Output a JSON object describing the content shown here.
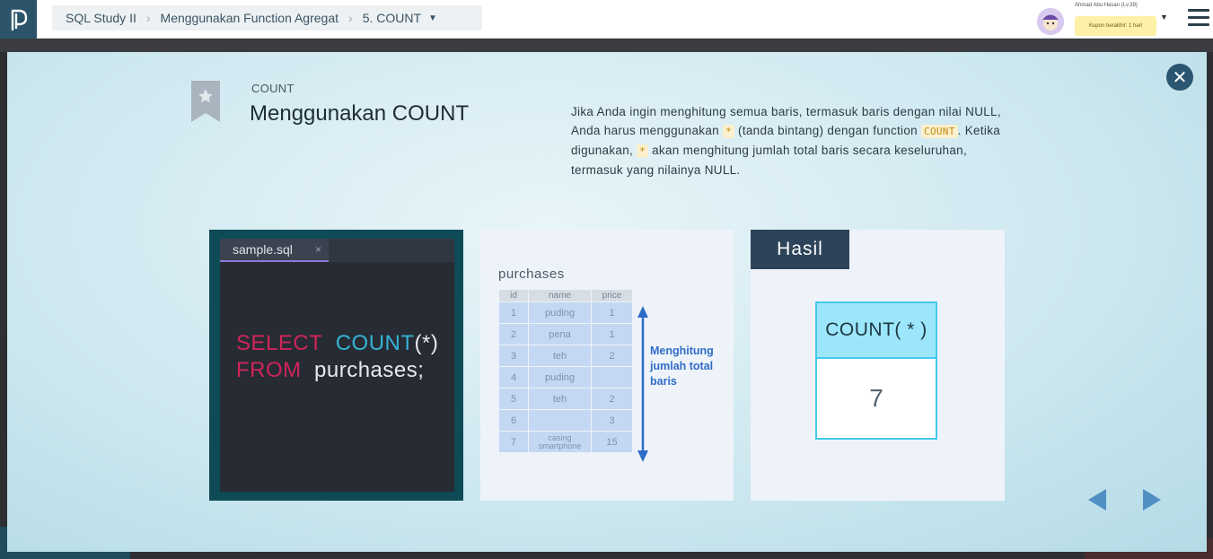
{
  "topbar": {
    "breadcrumb": [
      "SQL Study II",
      "Menggunakan Function Agregat",
      "5. COUNT"
    ],
    "user_name": "Ahmad Abu Hasan (Lv.39)",
    "coupon_text": "Kupon berakhir: 1 hari"
  },
  "slide": {
    "kicker": "COUNT",
    "title": "Menggunakan COUNT",
    "desc": {
      "p1": "Jika Anda ingin menghitung semua baris, termasuk baris dengan nilai NULL, Anda harus menggunakan ",
      "chip1": "*",
      "p2": " (tanda bintang) dengan function ",
      "chip2": "COUNT",
      "p3": ". Ketika digunakan, ",
      "chip3": "*",
      "p4": " akan menghitung jumlah total baris secara keseluruhan, termasuk yang nilainya NULL."
    }
  },
  "editor": {
    "filename": "sample.sql",
    "tab_close": "×",
    "line1": {
      "kw": "SELECT",
      "fn": "COUNT",
      "rest": "(*)"
    },
    "line2": {
      "kw": "FROM",
      "rest": "purchases;"
    }
  },
  "table": {
    "name": "purchases",
    "columns": [
      "id",
      "name",
      "price"
    ],
    "rows": [
      [
        "1",
        "puding",
        "1"
      ],
      [
        "2",
        "pena",
        "1"
      ],
      [
        "3",
        "teh",
        "2"
      ],
      [
        "4",
        "puding",
        ""
      ],
      [
        "5",
        "teh",
        "2"
      ],
      [
        "6",
        "",
        "3"
      ],
      [
        "7",
        "casing smartphone",
        "15"
      ]
    ],
    "arrow_note": [
      "Menghitung",
      "jumlah total",
      "baris"
    ]
  },
  "result": {
    "tag": "Hasil",
    "column": "COUNT( * )",
    "value": "7"
  },
  "colors": {
    "keyword": "#d0245a",
    "function": "#35b3d6",
    "accent": "#2a5671",
    "arrow": "#2f6cc7",
    "result_border": "#45c8ec"
  },
  "icons": {
    "close": "close-icon",
    "prev": "prev-arrow-icon",
    "next": "next-arrow-icon",
    "menu": "hamburger-menu-icon",
    "bookmark": "bookmark-star-icon"
  }
}
